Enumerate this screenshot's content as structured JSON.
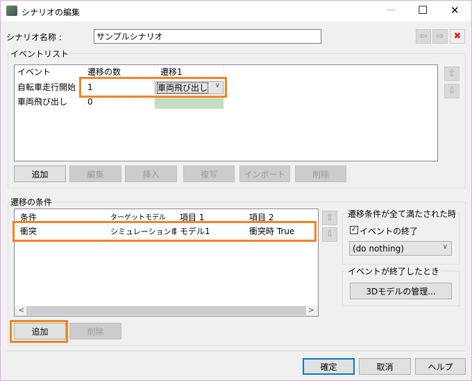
{
  "window": {
    "title": "シナリオの編集",
    "minimize": "—",
    "maximize": "☐",
    "close": "✕"
  },
  "scenario": {
    "label": "シナリオ名称 :",
    "value": "サンプルシナリオ"
  },
  "nav": {
    "prev": "⇦",
    "next": "⇨",
    "delete": "✖"
  },
  "event_list": {
    "title": "イベントリスト",
    "columns": [
      "イベント",
      "遷移の数",
      "遷移1"
    ],
    "rows": [
      {
        "event": "自転車走行開始",
        "count": "1",
        "transition1": "車両飛び出し"
      },
      {
        "event": "車両飛び出し",
        "count": "0",
        "transition1": ""
      }
    ],
    "buttons": [
      "追加",
      "編集",
      "挿入",
      "複写",
      "インポート",
      "削除"
    ],
    "up": "⇧",
    "down": "⇩"
  },
  "conditions": {
    "title": "遷移の条件",
    "columns": [
      "条件",
      "ターゲットモデル",
      "項目 1",
      "項目 2"
    ],
    "rows": [
      {
        "condition": "衝突",
        "target": "シミュレーション車両",
        "item1": "モデル1",
        "item2": "衝突時 True"
      }
    ],
    "buttons": [
      "追加",
      "削除"
    ],
    "scroll_left": "<",
    "scroll_right": ">",
    "up": "⇧",
    "down": "⇩"
  },
  "all_met": {
    "title": "遷移条件が全て満たされた時",
    "checkbox_label": "イベントの終了",
    "checked": true,
    "select_value": "(do nothing)"
  },
  "event_end": {
    "title": "イベントが終了したとき",
    "button": "3Dモデルの管理..."
  },
  "footer": {
    "ok": "確定",
    "cancel": "取消",
    "help": "ヘルプ"
  }
}
